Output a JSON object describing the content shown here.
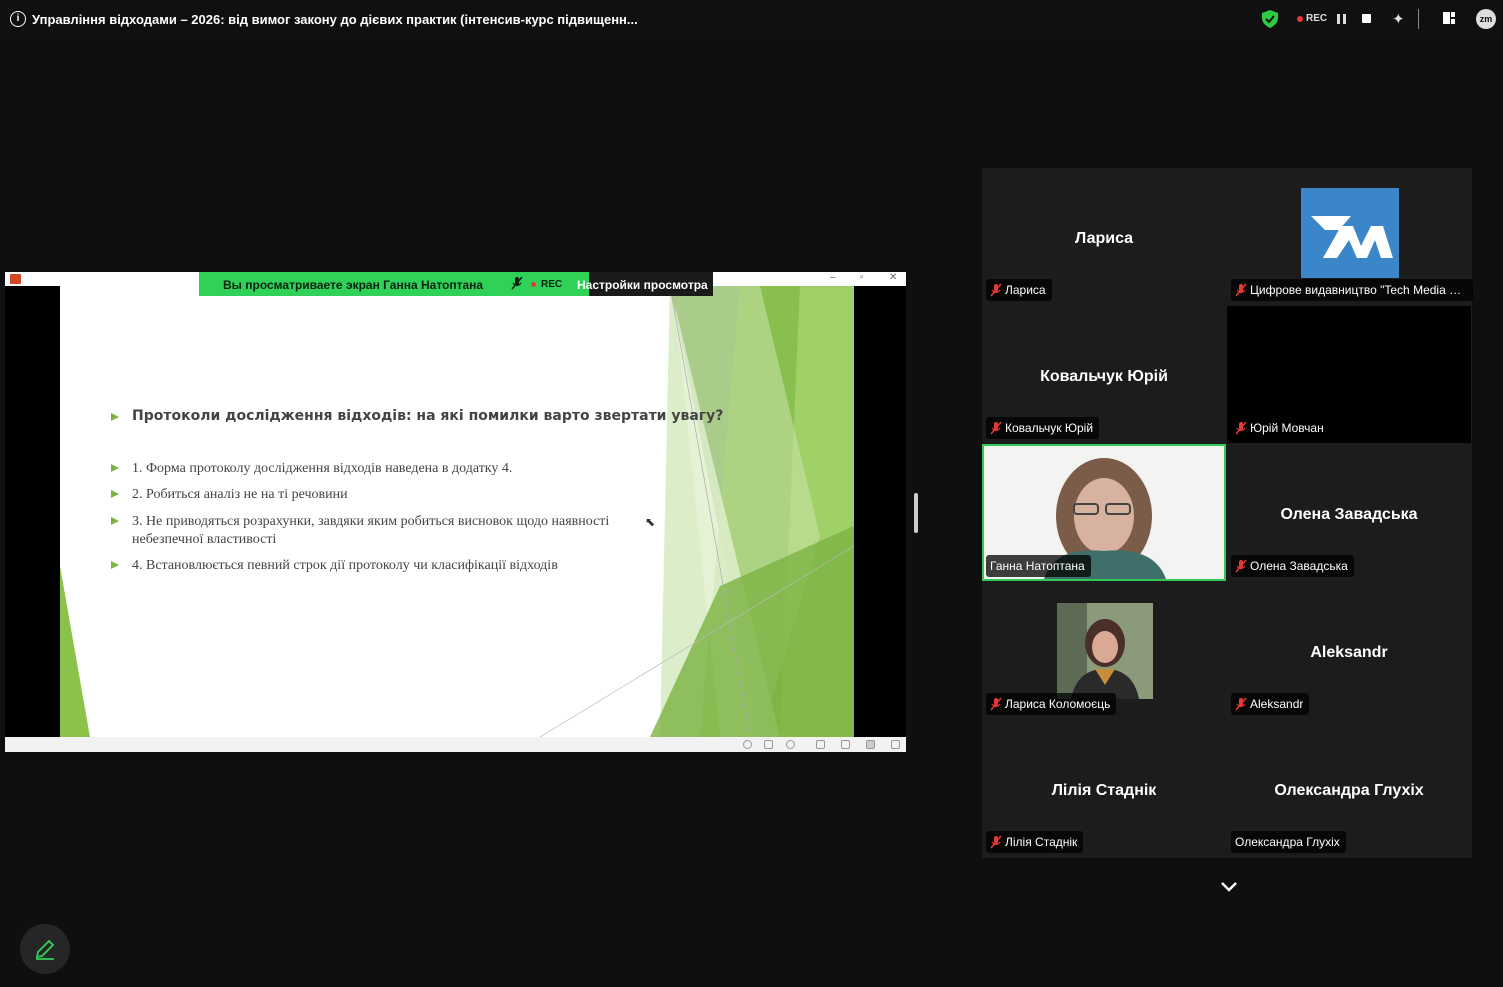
{
  "window": {
    "title": "Управління відходами – 2026: від вимог закону до дієвих практик (інтенсив-курс підвищенн...",
    "rec_label": "REC",
    "zoom_badge": "zm"
  },
  "share": {
    "banner_text": "Вы просматриваете экран  Ганна Натоптана",
    "banner_rec": "REC",
    "view_settings": "Настройки просмотра",
    "slide": {
      "title": "Протоколи дослідження відходів: на які помилки варто звертати увагу?",
      "items": [
        "1. Форма протоколу дослідження відходів наведена в додатку 4.",
        "2. Робиться аналіз не на ті речовини",
        "3. Не приводяться розрахунки, завдяки яким робиться висновок щодо наявності небезпечної властивості",
        "4. Встановлюється певний строк дії протоколу чи класифікації відходів"
      ],
      "accent_color": "#7cb342"
    }
  },
  "gallery": {
    "tiles": [
      {
        "name": "Лариса",
        "label": "Лариса",
        "muted": true
      },
      {
        "name": "",
        "label": "Цифрове видавництво \"Tech Media G...",
        "muted": true,
        "logo": true
      },
      {
        "name": "Ковальчук Юрій",
        "label": "Ковальчук Юрій",
        "muted": true
      },
      {
        "name": "",
        "label": "Юрій Мовчан",
        "muted": true
      },
      {
        "name": "",
        "label": "Ганна Натоптана",
        "muted": false,
        "active": true
      },
      {
        "name": "Олена Завадська",
        "label": "Олена Завадська",
        "muted": true
      },
      {
        "name": "",
        "label": "Лариса Коломоєць",
        "muted": true
      },
      {
        "name": "Aleksandr",
        "label": "Aleksandr",
        "muted": true
      },
      {
        "name": "Лілія Стаднік",
        "label": "Лілія Стаднік",
        "muted": true
      },
      {
        "name": "Олександра Глухіх",
        "label": "Олександра Глухіх",
        "muted": false
      }
    ],
    "active_speaker_color": "#35c759",
    "logo_color": "#3a86c8"
  }
}
